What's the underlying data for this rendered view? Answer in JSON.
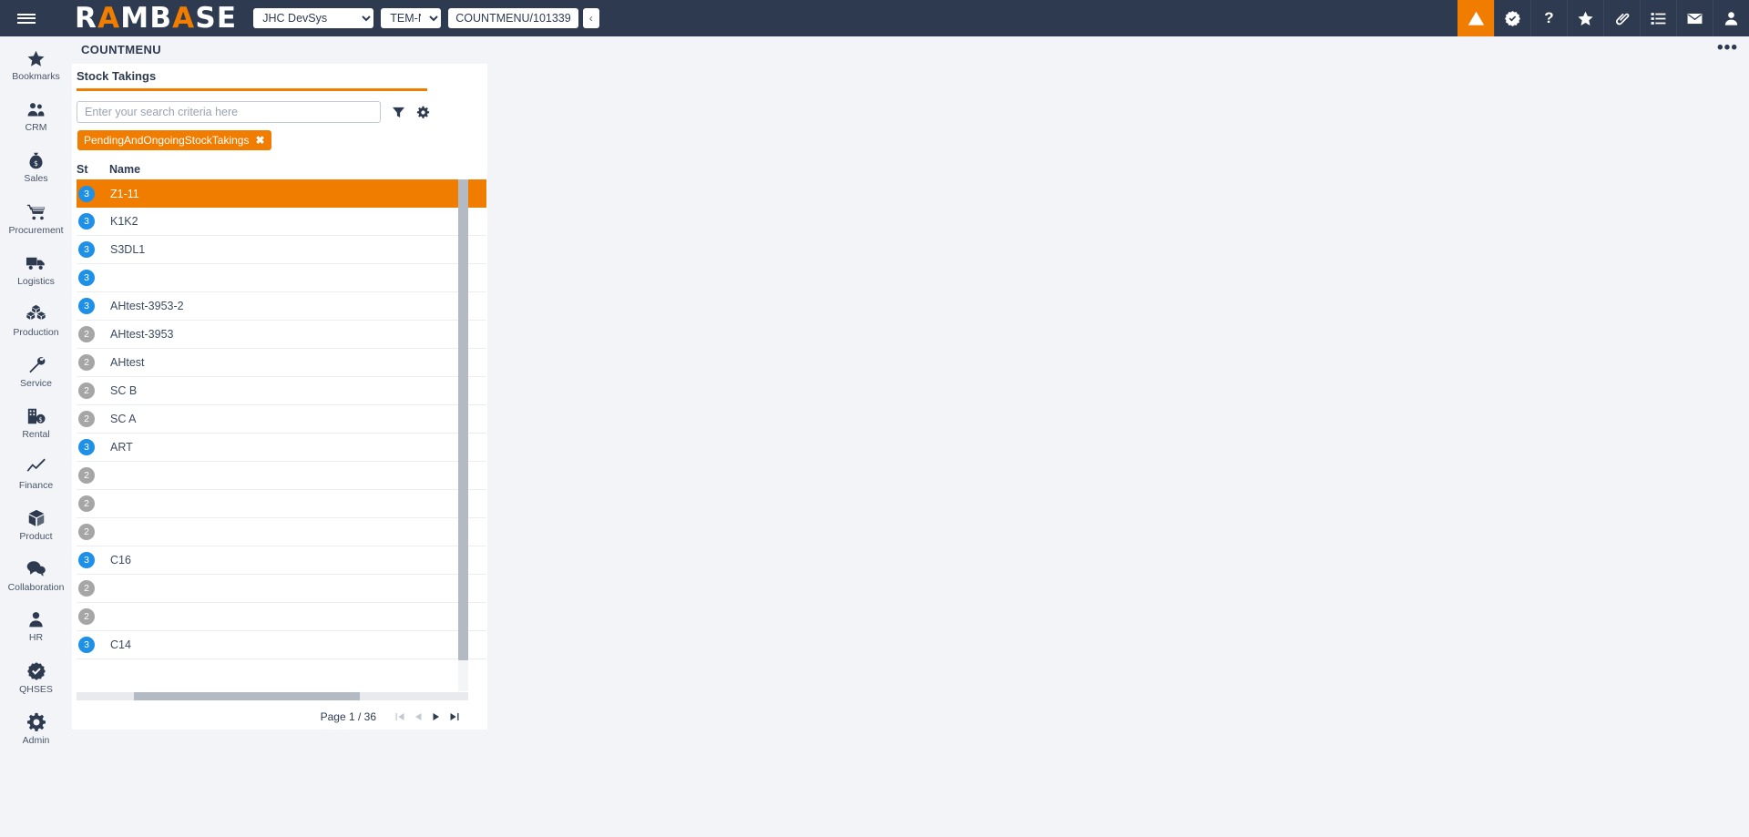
{
  "header": {
    "menu_icon": "hamburger-icon",
    "logo_text_1": "R",
    "logo_text_accent_1": "A",
    "logo_text_2": "MB",
    "logo_text_accent_2": "A",
    "logo_text_3": "SE",
    "logo_full": "RAMBASE",
    "company_selected": "JHC DevSys",
    "company_options": [
      "JHC DevSys"
    ],
    "unit_selected": "TEM-NO",
    "unit_options": [
      "TEM-NO"
    ],
    "document_id": "COUNTMENU/101339",
    "collapse_label": "‹",
    "icons": [
      {
        "name": "alert-warning-icon",
        "label": "Alerts",
        "active": true,
        "bg": "#f07d00"
      },
      {
        "name": "check-badge-icon",
        "label": "Approvals",
        "active": false
      },
      {
        "name": "help-question-icon",
        "label": "Help",
        "active": false
      },
      {
        "name": "star-favorite-icon",
        "label": "Favorites",
        "active": false
      },
      {
        "name": "paperclip-attachment-icon",
        "label": "Attachments",
        "active": false
      },
      {
        "name": "list-tasks-icon",
        "label": "Tasks",
        "active": false
      },
      {
        "name": "envelope-mail-icon",
        "label": "Messages",
        "active": false
      },
      {
        "name": "user-account-icon",
        "label": "Account",
        "active": false
      }
    ]
  },
  "sidebar": {
    "items": [
      {
        "label": "Bookmarks",
        "icon": "star-icon"
      },
      {
        "label": "CRM",
        "icon": "people-icon"
      },
      {
        "label": "Sales",
        "icon": "money-bag-icon"
      },
      {
        "label": "Procurement",
        "icon": "shopping-cart-icon"
      },
      {
        "label": "Logistics",
        "icon": "truck-icon"
      },
      {
        "label": "Production",
        "icon": "boxes-icon"
      },
      {
        "label": "Service",
        "icon": "wrench-icon"
      },
      {
        "label": "Rental",
        "icon": "building-money-icon"
      },
      {
        "label": "Finance",
        "icon": "chart-line-icon"
      },
      {
        "label": "Product",
        "icon": "cube-icon"
      },
      {
        "label": "Collaboration",
        "icon": "chat-bubbles-icon"
      },
      {
        "label": "HR",
        "icon": "person-icon"
      },
      {
        "label": "QHSES",
        "icon": "check-badge-icon"
      },
      {
        "label": "Admin",
        "icon": "gear-icon"
      }
    ]
  },
  "content": {
    "page_title": "COUNTMENU",
    "ellipsis_label": "•••",
    "tab_label": "Stock Takings",
    "search": {
      "value": "",
      "placeholder": "Enter your search criteria here",
      "filter_icon": "funnel-filter-icon",
      "settings_icon": "gear-icon"
    },
    "filter_chip": {
      "label": "PendingAndOngoingStockTakings",
      "remove_label": "✖"
    },
    "table": {
      "columns": [
        "St",
        "Name"
      ],
      "rows": [
        {
          "st": "3",
          "name": "Z1-11",
          "selected": true
        },
        {
          "st": "3",
          "name": "K1K2",
          "selected": false
        },
        {
          "st": "3",
          "name": "S3DL1",
          "selected": false
        },
        {
          "st": "3",
          "name": "",
          "selected": false
        },
        {
          "st": "3",
          "name": "AHtest-3953-2",
          "selected": false
        },
        {
          "st": "2",
          "name": "AHtest-3953",
          "selected": false
        },
        {
          "st": "2",
          "name": "AHtest",
          "selected": false
        },
        {
          "st": "2",
          "name": "SC B",
          "selected": false
        },
        {
          "st": "2",
          "name": "SC A",
          "selected": false
        },
        {
          "st": "3",
          "name": "ART",
          "selected": false
        },
        {
          "st": "2",
          "name": "",
          "selected": false
        },
        {
          "st": "2",
          "name": "",
          "selected": false
        },
        {
          "st": "2",
          "name": "",
          "selected": false
        },
        {
          "st": "3",
          "name": "C16",
          "selected": false
        },
        {
          "st": "2",
          "name": "",
          "selected": false
        },
        {
          "st": "2",
          "name": "",
          "selected": false
        },
        {
          "st": "3",
          "name": "C14",
          "selected": false
        }
      ]
    },
    "pagination": {
      "label": "Page 1 / 36",
      "current_page": 1,
      "total_pages": 36,
      "first_enabled": false,
      "prev_enabled": false,
      "next_enabled": true,
      "last_enabled": true
    }
  },
  "colors": {
    "header_bg": "#2e3a50",
    "accent_orange": "#f07d00",
    "sidebar_bg": "#f2f4f7",
    "status_3_blue": "#1e90e8",
    "status_2_gray": "#a6a6a6",
    "panel_bg": "#ffffff"
  }
}
